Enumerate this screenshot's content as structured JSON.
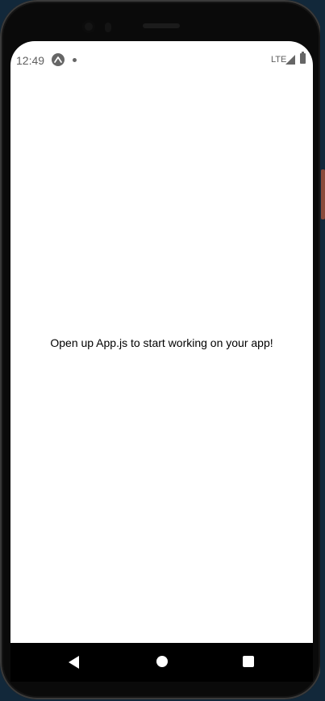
{
  "status_bar": {
    "time": "12:49",
    "network": "LTE",
    "icons": {
      "app": "expo-icon",
      "notification": "dot-icon",
      "signal": "signal-icon",
      "battery": "battery-icon"
    }
  },
  "main": {
    "message": "Open up App.js to start working on your app!"
  },
  "nav_bar": {
    "icons": {
      "back": "back-triangle-icon",
      "home": "home-circle-icon",
      "recents": "recents-square-icon"
    }
  },
  "colors": {
    "page_background": "#12283a",
    "device": "#0a0a0a",
    "screen": "#ffffff",
    "status_text": "#5f5f5f",
    "nav_bar": "#000000",
    "nav_icons": "#ffffff"
  }
}
